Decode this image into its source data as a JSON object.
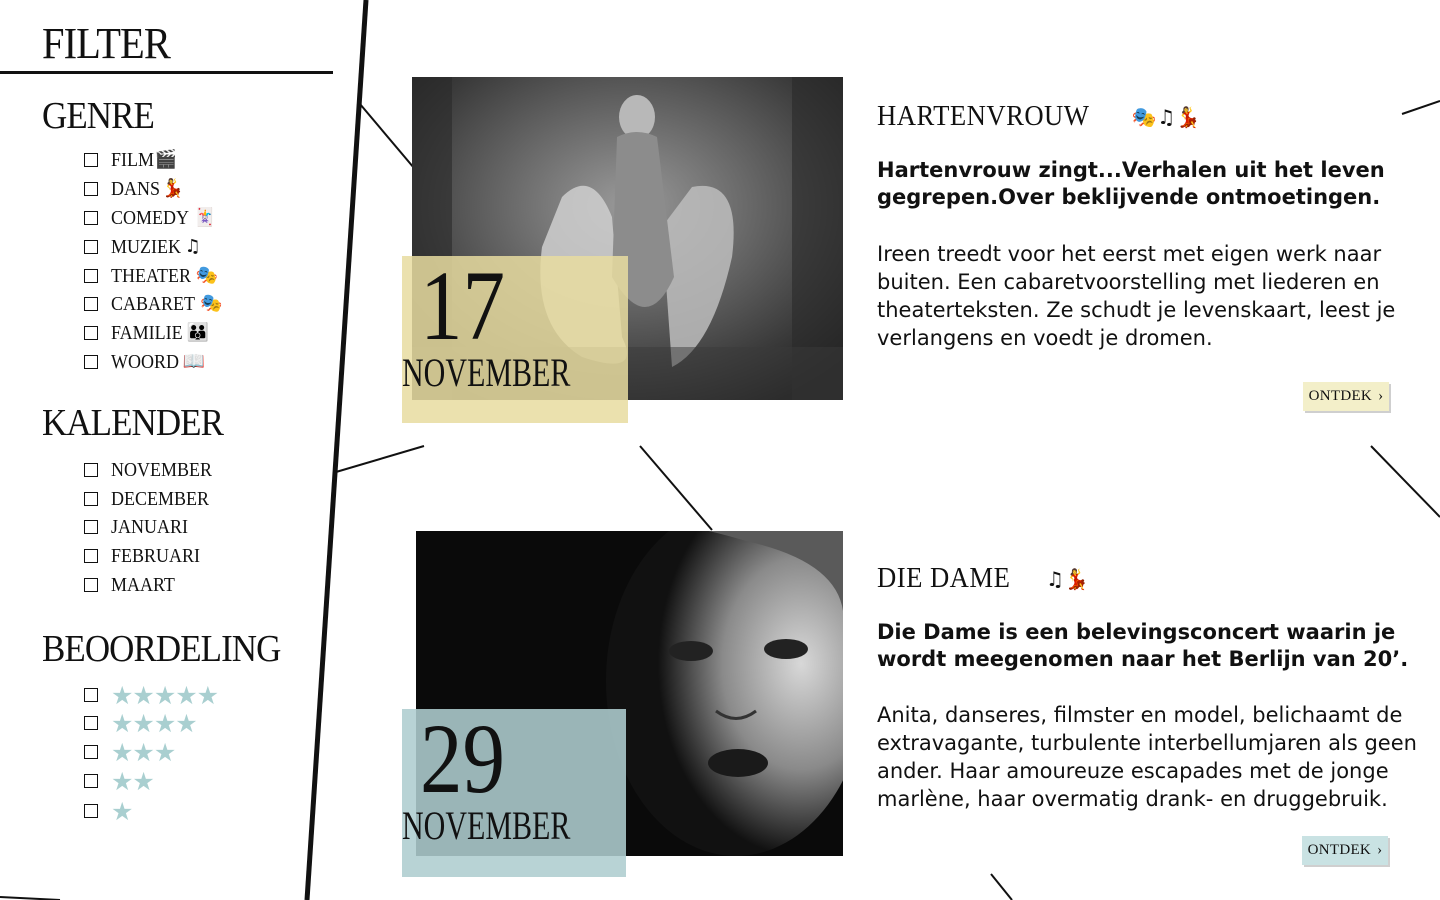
{
  "sidebar": {
    "title": "FILTER",
    "genre": {
      "title": "GENRE",
      "items": [
        {
          "label": "FILM",
          "icon": "🎬",
          "icon_name": "film-clapper-icon"
        },
        {
          "label": "DANS",
          "icon": "💃",
          "icon_name": "dancer-icon"
        },
        {
          "label": "COMEDY",
          "icon": "🃏",
          "icon_name": "jester-icon"
        },
        {
          "label": "MUZIEK",
          "icon": "♫",
          "icon_name": "music-note-icon"
        },
        {
          "label": "THEATER",
          "icon": "🎭",
          "icon_name": "stage-curtain-icon"
        },
        {
          "label": "CABARET",
          "icon": "🎭",
          "icon_name": "theater-masks-icon"
        },
        {
          "label": "FAMILIE",
          "icon": "👪",
          "icon_name": "family-icon"
        },
        {
          "label": "WOORD",
          "icon": "📖",
          "icon_name": "open-book-icon"
        }
      ]
    },
    "kalender": {
      "title": "KALENDER",
      "items": [
        "NOVEMBER",
        "DECEMBER",
        "JANUARI",
        "FEBRUARI",
        "MAART"
      ]
    },
    "beoordeling": {
      "title": "BEOORDELING",
      "items": [
        {
          "stars": "★★★★★",
          "rating": 5
        },
        {
          "stars": "★★★★",
          "rating": 4
        },
        {
          "stars": "★★★",
          "rating": 3
        },
        {
          "stars": "★★",
          "rating": 2
        },
        {
          "stars": "★",
          "rating": 1
        }
      ],
      "star_color": "#a9cfd0"
    }
  },
  "events": [
    {
      "day": "17",
      "month": "NOVEMBER",
      "title": "HARTENVROUW",
      "icons": "🎭♫💃",
      "icon_names": [
        "theater-masks-icon",
        "music-note-icon",
        "dancer-icon"
      ],
      "lead": "Hartenvrouw zingt...Verhalen uit het leven gegrepen.Over beklijvende ontmoetingen.",
      "body": "Ireen treedt voor het eerst met eigen werk naar buiten. Een cabaretvoorstelling met liederen en theaterteksten. Ze schudt je levenskaart, leest je verlangens en voedt je dromen.",
      "button": "ONTDEK",
      "date_color": "#e8dca0",
      "button_color": "#f3efc9"
    },
    {
      "day": "29",
      "month": "NOVEMBER",
      "title": "DIE DAME",
      "icons": "♫💃",
      "icon_names": [
        "music-note-icon",
        "dancer-icon"
      ],
      "lead": "Die Dame is een belevingsconcert waarin je wordt meegenomen naar het Berlijn van 20’.",
      "body": "Anita, danseres, filmster en model, belichaamt de extravagante, turbulente interbellumjaren als geen ander. Haar amoureuze escapades met de jonge marlène, haar overmatig drank- en druggebruik.",
      "button": "ONTDEK",
      "date_color": "#aecdcf",
      "button_color": "#c9e2e3"
    }
  ]
}
